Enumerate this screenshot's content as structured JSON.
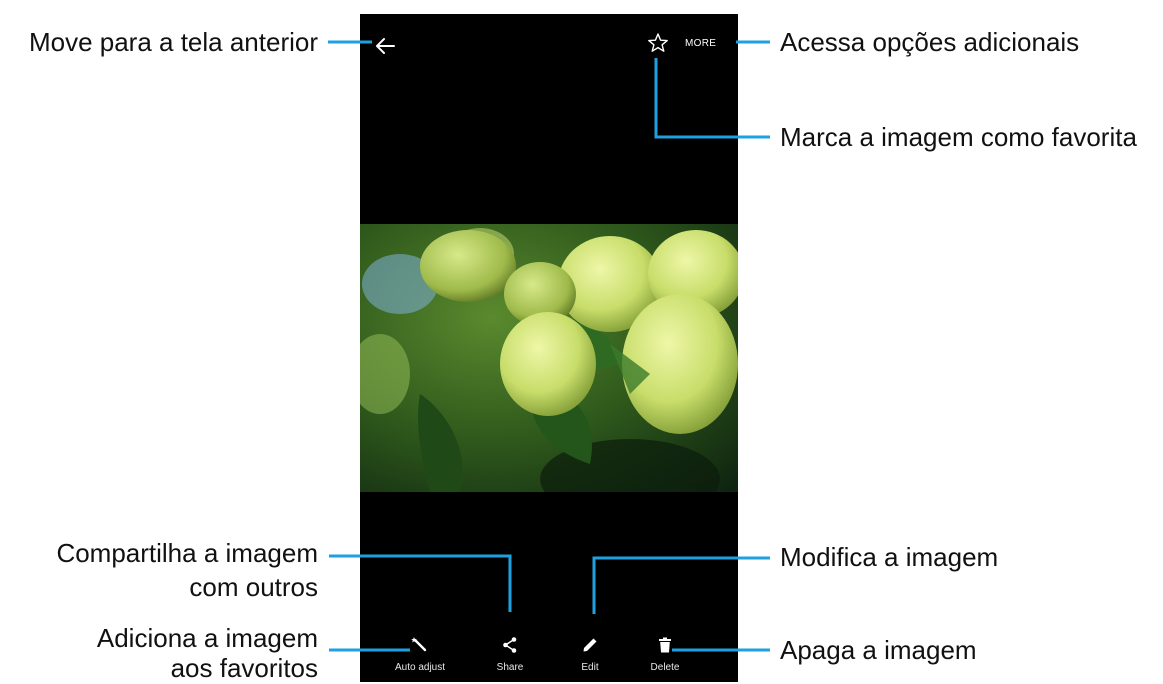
{
  "screen": {
    "more_label": "MORE",
    "back_icon": "arrow-left-icon",
    "favorite_icon": "star-outline-icon"
  },
  "actions": [
    {
      "label": "Auto adjust",
      "icon": "magic-wand-icon"
    },
    {
      "label": "Share",
      "icon": "share-icon"
    },
    {
      "label": "Edit",
      "icon": "pencil-icon"
    },
    {
      "label": "Delete",
      "icon": "trash-icon"
    }
  ],
  "callouts": {
    "back": "Move para a tela anterior",
    "more": "Acessa opções adicionais",
    "favorite": "Marca a imagem como favorita",
    "share_line1": "Compartilha a imagem",
    "share_line2": "com outros",
    "auto_line1": "Adiciona a imagem",
    "auto_line2": "aos favoritos",
    "edit": "Modifica a imagem",
    "delete": "Apaga a imagem"
  },
  "colors": {
    "leader": "#1fa0e0",
    "screen_bg": "#000000"
  }
}
